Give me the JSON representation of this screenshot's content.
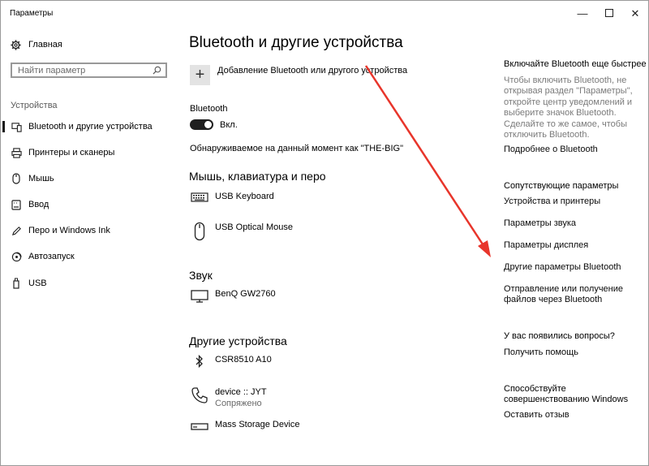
{
  "window": {
    "title": "Параметры",
    "minimize": "—",
    "close": "✕"
  },
  "sidebar": {
    "home": "Главная",
    "search_placeholder": "Найти параметр",
    "section": "Устройства",
    "items": [
      {
        "label": "Bluetooth и другие устройства",
        "icon": "bluetooth-devices-icon"
      },
      {
        "label": "Принтеры и сканеры",
        "icon": "printer-icon"
      },
      {
        "label": "Мышь",
        "icon": "mouse-icon"
      },
      {
        "label": "Ввод",
        "icon": "keyboard-icon"
      },
      {
        "label": "Перо и Windows Ink",
        "icon": "pen-icon"
      },
      {
        "label": "Автозапуск",
        "icon": "autoplay-icon"
      },
      {
        "label": "USB",
        "icon": "usb-icon"
      }
    ]
  },
  "main": {
    "title": "Bluetooth и другие устройства",
    "add_label": "Добавление Bluetooth или другого устройства",
    "bluetooth_label": "Bluetooth",
    "toggle_state": "Вкл.",
    "discoverable": "Обнаруживаемое на данный момент как \"THE-BIG\"",
    "sections": {
      "input": "Мышь, клавиатура и перо",
      "audio": "Звук",
      "other": "Другие устройства"
    },
    "devices": {
      "keyboard": "USB Keyboard",
      "mouse": "USB Optical Mouse",
      "monitor": "BenQ GW2760",
      "bt_adapter": "CSR8510 A10",
      "phone": "device :: JYT",
      "phone_status": "Сопряжено",
      "storage": "Mass Storage Device"
    }
  },
  "right": {
    "tip_heading": "Включайте Bluetooth еще быстрее",
    "tip_text": "Чтобы включить Bluetooth, не открывая раздел \"Параметры\", откройте центр уведомлений и выберите значок Bluetooth. Сделайте то же самое, чтобы отключить Bluetooth.",
    "more_link": "Подробнее о Bluetooth",
    "related_heading": "Сопутствующие параметры",
    "related_links": [
      "Устройства и принтеры",
      "Параметры звука",
      "Параметры дисплея",
      "Другие параметры Bluetooth",
      "Отправление или получение файлов через Bluetooth"
    ],
    "questions_heading": "У вас появились вопросы?",
    "help_link": "Получить помощь",
    "feedback_heading": "Способствуйте совершенствованию Windows",
    "feedback_link": "Оставить отзыв"
  },
  "colors": {
    "arrow": "#e8352b",
    "toggle_on": "#1f1f1f"
  }
}
